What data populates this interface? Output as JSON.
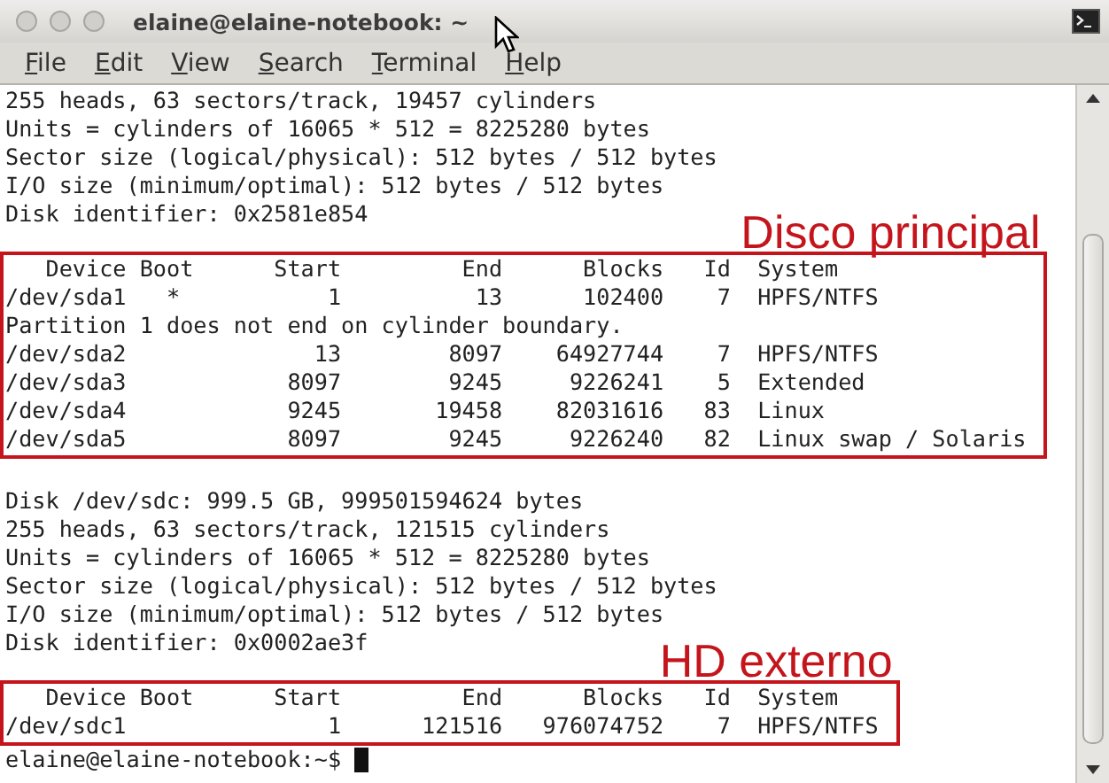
{
  "window": {
    "title": "elaine@elaine-notebook: ~"
  },
  "menu": [
    "File",
    "Edit",
    "View",
    "Search",
    "Terminal",
    "Help"
  ],
  "terminal": {
    "blocks": [
      {
        "kind": "text",
        "lines": [
          "255 heads, 63 sectors/track, 19457 cylinders",
          "Units = cylinders of 16065 * 512 = 8225280 bytes",
          "Sector size (logical/physical): 512 bytes / 512 bytes",
          "I/O size (minimum/optimal): 512 bytes / 512 bytes",
          "Disk identifier: 0x2581e854"
        ]
      },
      {
        "kind": "annotated",
        "label": "Disco principal",
        "lines": [
          "   Device Boot      Start         End      Blocks   Id  System",
          "/dev/sda1   *           1          13      102400    7  HPFS/NTFS",
          "Partition 1 does not end on cylinder boundary.",
          "/dev/sda2              13        8097    64927744    7  HPFS/NTFS",
          "/dev/sda3            8097        9245     9226241    5  Extended",
          "/dev/sda4            9245       19458    82031616   83  Linux",
          "/dev/sda5            8097        9245     9226240   82  Linux swap / Solaris"
        ]
      },
      {
        "kind": "blank"
      },
      {
        "kind": "text",
        "lines": [
          "Disk /dev/sdc: 999.5 GB, 999501594624 bytes",
          "255 heads, 63 sectors/track, 121515 cylinders",
          "Units = cylinders of 16065 * 512 = 8225280 bytes",
          "Sector size (logical/physical): 512 bytes / 512 bytes",
          "I/O size (minimum/optimal): 512 bytes / 512 bytes",
          "Disk identifier: 0x0002ae3f"
        ]
      },
      {
        "kind": "annotated",
        "label": "HD externo",
        "lines": [
          "   Device Boot      Start         End      Blocks   Id  System",
          "/dev/sdc1               1      121516   976074752    7  HPFS/NTFS"
        ]
      },
      {
        "kind": "prompt",
        "text": "elaine@elaine-notebook:~$ "
      }
    ]
  }
}
